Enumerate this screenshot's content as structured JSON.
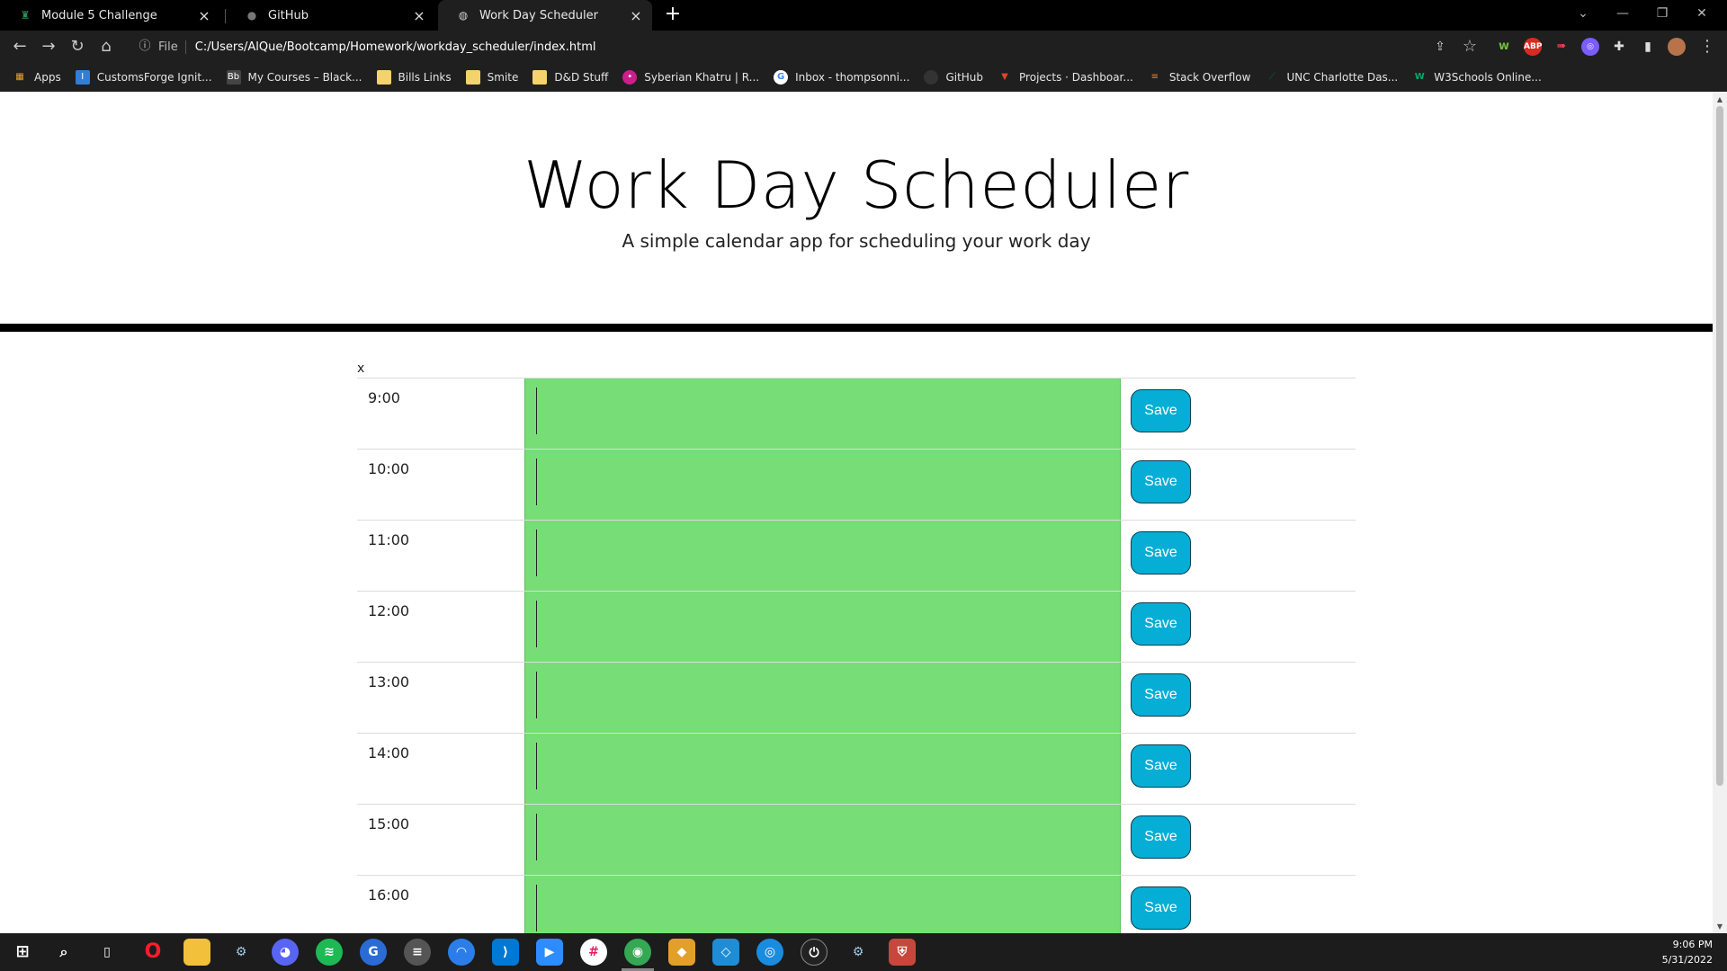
{
  "browser": {
    "tabs": [
      {
        "title": "Module 5 Challenge",
        "icon": "rook-icon",
        "active": false
      },
      {
        "title": "GitHub",
        "icon": "github-icon",
        "active": false
      },
      {
        "title": "Work Day Scheduler",
        "icon": "globe-icon",
        "active": true
      }
    ],
    "address": {
      "scheme_label": "File",
      "url": "C:/Users/AlQue/Bootcamp/Homework/workday_scheduler/index.html"
    },
    "bookmarks": [
      {
        "label": "Apps",
        "icon": "apps-grid-icon",
        "color": "#e8a52b"
      },
      {
        "label": "CustomsForge Ignit...",
        "icon": "cf-icon",
        "color": "#2f7fd6"
      },
      {
        "label": "My Courses – Black...",
        "icon": "bb-icon",
        "color": "#444444"
      },
      {
        "label": "Bills Links",
        "icon": "folder-icon",
        "color": "#f5d26b"
      },
      {
        "label": "Smite",
        "icon": "folder-icon",
        "color": "#f5d26b"
      },
      {
        "label": "D&D Stuff",
        "icon": "folder-icon",
        "color": "#f5d26b"
      },
      {
        "label": "Syberian Khatru | R...",
        "icon": "sk-icon",
        "color": "#cc1f8a"
      },
      {
        "label": "Inbox - thompsonni...",
        "icon": "google-icon",
        "color": "#ffffff"
      },
      {
        "label": "GitHub",
        "icon": "github-icon",
        "color": "#333333"
      },
      {
        "label": "Projects · Dashboar...",
        "icon": "gitlab-icon",
        "color": "#e24329"
      },
      {
        "label": "Stack Overflow",
        "icon": "stackoverflow-icon",
        "color": "#f48024"
      },
      {
        "label": "UNC Charlotte Das...",
        "icon": "unc-icon",
        "color": "#00703c"
      },
      {
        "label": "W3Schools Online...",
        "icon": "w3schools-icon",
        "color": "#04aa6d"
      }
    ]
  },
  "app": {
    "title": "Work Day Scheduler",
    "lead": "A simple calendar app for scheduling your work day",
    "current_day": "x",
    "save_label": "Save",
    "row_color": "#77dd77",
    "save_color": "#06aed5",
    "hours": [
      "9:00",
      "10:00",
      "11:00",
      "12:00",
      "13:00",
      "14:00",
      "15:00",
      "16:00"
    ]
  },
  "taskbar": {
    "time": "9:06 PM",
    "date": "5/31/2022"
  }
}
